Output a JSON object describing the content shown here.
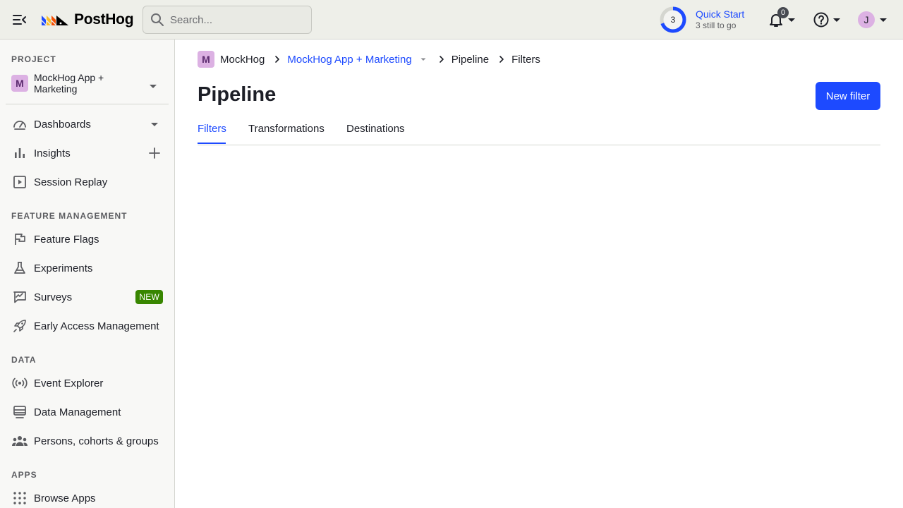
{
  "topbar": {
    "logo_text": "PostHog",
    "search_placeholder": "Search...",
    "quickstart": {
      "count": "3",
      "title": "Quick Start",
      "subtitle": "3 still to go"
    },
    "notifications_count": "0",
    "user_initial": "J"
  },
  "sidebar": {
    "project_label": "PROJECT",
    "project": {
      "initial": "M",
      "name": "MockHog App + Marketing"
    },
    "items_top": [
      {
        "label": "Dashboards"
      },
      {
        "label": "Insights"
      },
      {
        "label": "Session Replay"
      }
    ],
    "feature_label": "FEATURE MANAGEMENT",
    "items_feature": [
      {
        "label": "Feature Flags"
      },
      {
        "label": "Experiments"
      },
      {
        "label": "Surveys",
        "badge": "NEW"
      },
      {
        "label": "Early Access Management"
      }
    ],
    "data_label": "DATA",
    "items_data": [
      {
        "label": "Event Explorer"
      },
      {
        "label": "Data Management"
      },
      {
        "label": "Persons, cohorts & groups"
      }
    ],
    "apps_label": "APPS",
    "items_apps": [
      {
        "label": "Browse Apps"
      }
    ]
  },
  "breadcrumb": {
    "org_initial": "M",
    "org": "MockHog",
    "project": "MockHog App + Marketing",
    "section": "Pipeline",
    "page": "Filters"
  },
  "main": {
    "title": "Pipeline",
    "new_button": "New filter",
    "tabs": [
      {
        "label": "Filters",
        "active": true
      },
      {
        "label": "Transformations",
        "active": false
      },
      {
        "label": "Destinations",
        "active": false
      }
    ]
  },
  "colors": {
    "accent": "#1d4aff",
    "badge_new": "#388600",
    "avatar": "#dcb1e3"
  }
}
